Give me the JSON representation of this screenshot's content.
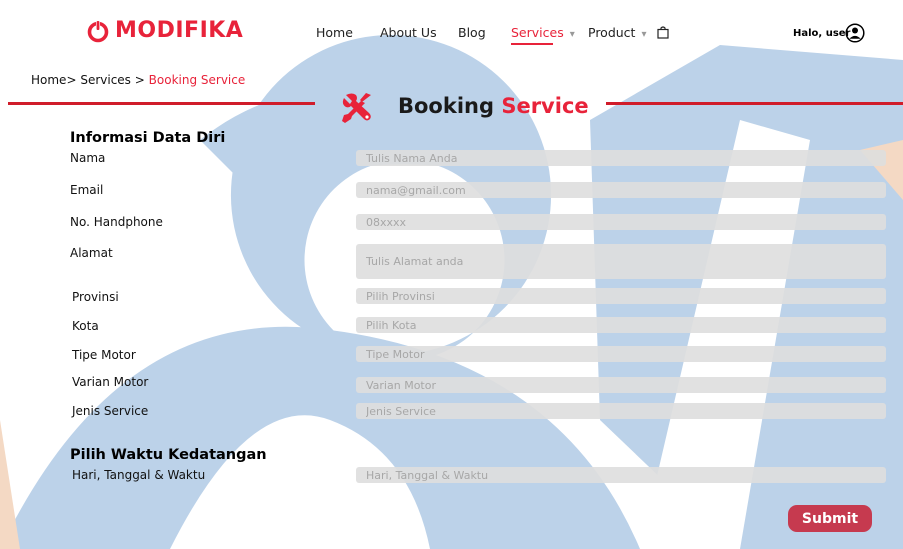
{
  "brand": {
    "name": "MODIFIKA",
    "color": "#e8233a"
  },
  "nav": {
    "items": [
      {
        "label": "Home"
      },
      {
        "label": "About Us"
      },
      {
        "label": "Blog"
      },
      {
        "label": "Services",
        "active": true,
        "has_dropdown": true
      },
      {
        "label": "Product",
        "has_dropdown": true
      }
    ],
    "cart_icon": "shopping-bag-icon",
    "greeting": "Halo, user",
    "user_icon": "user-circle-icon"
  },
  "breadcrumb": {
    "home": "Home",
    "sep": ">",
    "services": "Services",
    "current": "Booking Service"
  },
  "page_title": {
    "main": "Booking",
    "accent": "Service",
    "icon": "tools-icon"
  },
  "personal": {
    "title": "Informasi Data Diri",
    "fields": [
      {
        "label": "Nama",
        "placeholder": "Tulis Nama Anda"
      },
      {
        "label": "Email",
        "placeholder": "nama@gmail.com"
      },
      {
        "label": "No. Handphone",
        "placeholder": "08xxxx"
      },
      {
        "label": "Alamat",
        "placeholder": "Tulis Alamat anda"
      },
      {
        "label": "Provinsi",
        "placeholder": "Pilih Provinsi"
      },
      {
        "label": "Kota",
        "placeholder": "Pilih Kota"
      },
      {
        "label": "Tipe Motor",
        "placeholder": "Tipe Motor"
      },
      {
        "label": "Varian Motor",
        "placeholder": "Varian Motor"
      },
      {
        "label": "Jenis Service",
        "placeholder": "Jenis Service"
      }
    ]
  },
  "arrival": {
    "title": "Pilih Waktu Kedatangan",
    "field": {
      "label": "Hari, Tanggal & Waktu",
      "placeholder": "Hari, Tanggal & Waktu"
    }
  },
  "submit_label": "Submit",
  "colors": {
    "accent": "#e8233a",
    "divider": "#d01c2a",
    "submit": "#c63a4f",
    "watermark": "#b9d0e8"
  }
}
